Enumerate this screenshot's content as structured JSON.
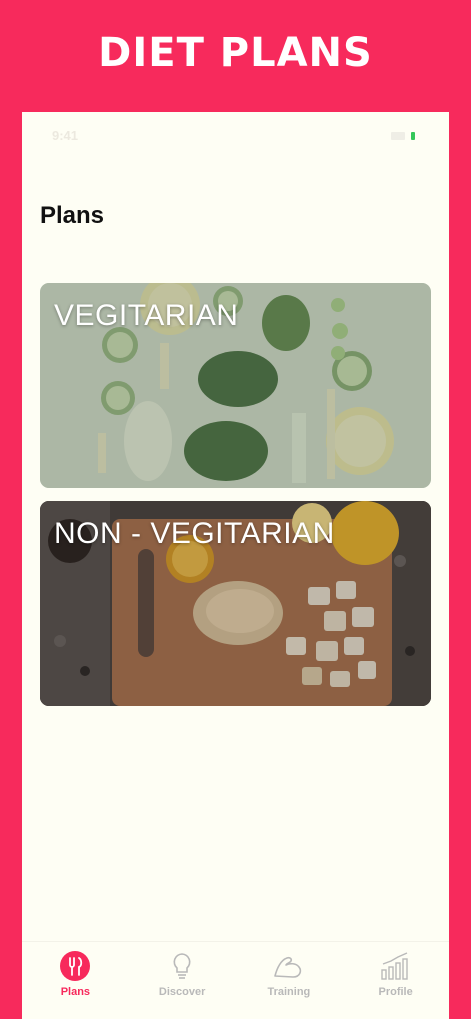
{
  "header": {
    "title": "DIET PLANS"
  },
  "status_bar": {
    "time": "9:41"
  },
  "page": {
    "title": "Plans"
  },
  "plans": [
    {
      "label": "VEGITARIAN"
    },
    {
      "label": "NON - VEGITARIAN"
    }
  ],
  "tab_bar": {
    "tabs": [
      {
        "label": "Plans",
        "icon": "fork-knife-icon",
        "active": true
      },
      {
        "label": "Discover",
        "icon": "lightbulb-icon",
        "active": false
      },
      {
        "label": "Training",
        "icon": "flexed-arm-icon",
        "active": false
      },
      {
        "label": "Profile",
        "icon": "bar-chart-icon",
        "active": false
      }
    ]
  },
  "colors": {
    "brand": "#f72a5c",
    "background": "#fefef4",
    "inactive": "#b9b9b9",
    "battery": "#34c759"
  }
}
